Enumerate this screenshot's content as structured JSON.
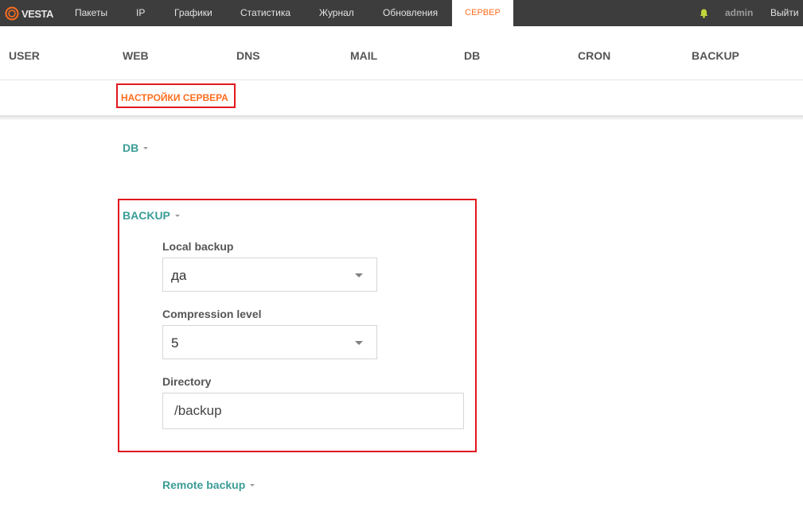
{
  "topbar": {
    "logo_text": "VESTA",
    "nav": [
      "Пакеты",
      "IP",
      "Графики",
      "Статистика",
      "Журнал",
      "Обновления"
    ],
    "active_tab": "СЕРВЕР",
    "user": "admin",
    "logout": "Выйти"
  },
  "menu": [
    "USER",
    "WEB",
    "DNS",
    "MAIL",
    "DB",
    "CRON",
    "BACKUP"
  ],
  "subbar": {
    "server_settings": "НАСТРОЙКИ СЕРВЕРА"
  },
  "sections": {
    "db": {
      "title": "DB"
    },
    "backup": {
      "title": "BACKUP",
      "local_backup": {
        "label": "Local backup",
        "value": "да"
      },
      "compression": {
        "label": "Compression level",
        "value": "5"
      },
      "directory": {
        "label": "Directory",
        "value": "/backup"
      },
      "remote_backup": {
        "title": "Remote backup"
      }
    }
  },
  "colors": {
    "topbar_bg": "#3d3d3d",
    "accent_orange": "#ff6e1f",
    "section_teal": "#3a9d97",
    "highlight_red": "#e0181e"
  }
}
